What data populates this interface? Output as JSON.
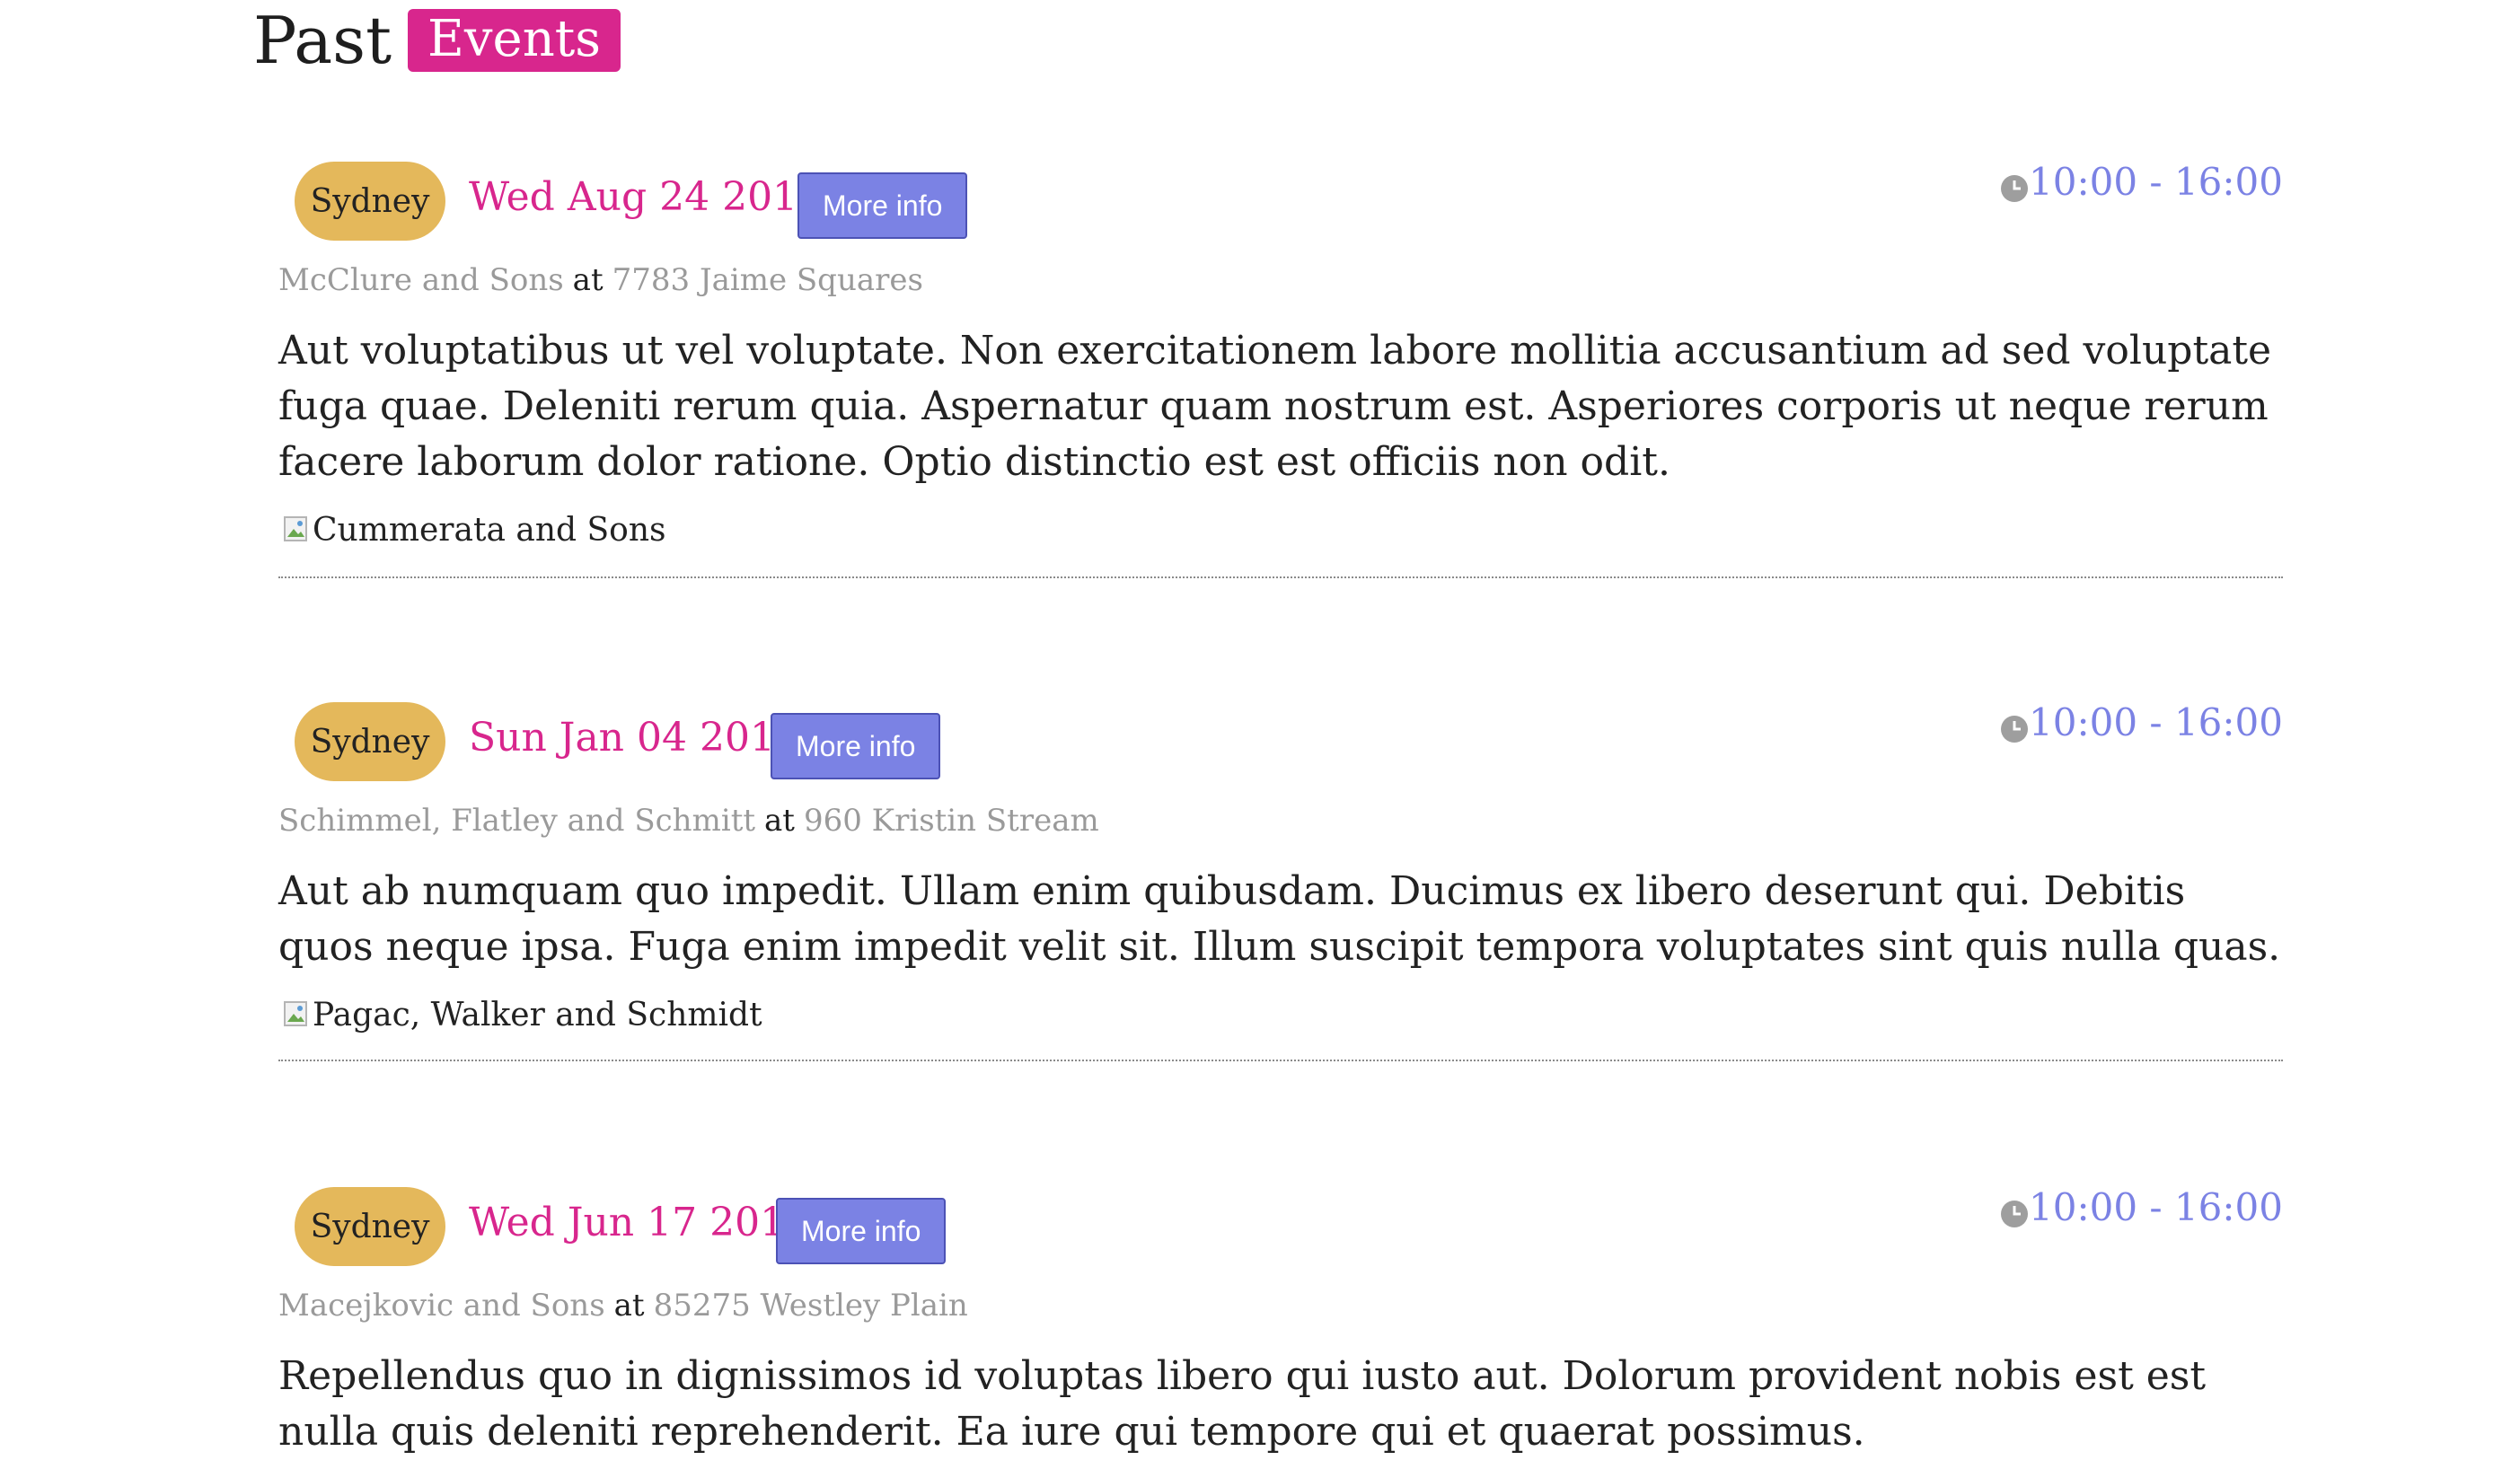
{
  "heading": {
    "title": "Past",
    "badge": "Events"
  },
  "colors": {
    "accent_pink": "#d8268d",
    "city_badge": "#e4b85b",
    "button_blue": "#7b82e4",
    "muted_text": "#9a9a9a"
  },
  "events": [
    {
      "city": "Sydney",
      "date": "Wed Aug 24 2016",
      "button": "More info",
      "time": "10:00 - 16:00",
      "organizer": "McClure and Sons",
      "at": "at",
      "address": "7783 Jaime Squares",
      "description": "Aut voluptatibus ut vel voluptate. Non exercitationem labore mollitia accusantium ad sed voluptate fuga quae. Deleniti rerum quia. Aspernatur quam nostrum est. Asperiores corporis ut neque rerum facere laborum dolor ratione. Optio distinctio est est officiis non odit.",
      "image_alt": "Cummerata and Sons"
    },
    {
      "city": "Sydney",
      "date": "Sun Jan 04 2015",
      "button": "More info",
      "time": "10:00 - 16:00",
      "organizer": "Schimmel, Flatley and Schmitt",
      "at": "at",
      "address": "960 Kristin Stream",
      "description": "Aut ab numquam quo impedit. Ullam enim quibusdam. Ducimus ex libero deserunt qui. Debitis quos neque ipsa. Fuga enim impedit velit sit. Illum suscipit tempora voluptates sint quis nulla quas.",
      "image_alt": "Pagac, Walker and Schmidt"
    },
    {
      "city": "Sydney",
      "date": "Wed Jun 17 2015",
      "button": "More info",
      "time": "10:00 - 16:00",
      "organizer": "Macejkovic and Sons",
      "at": "at",
      "address": "85275 Westley Plain",
      "description": "Repellendus quo in dignissimos id voluptas libero qui iusto aut. Dolorum provident nobis est est nulla quis deleniti reprehenderit. Ea iure qui tempore qui et quaerat possimus."
    }
  ]
}
